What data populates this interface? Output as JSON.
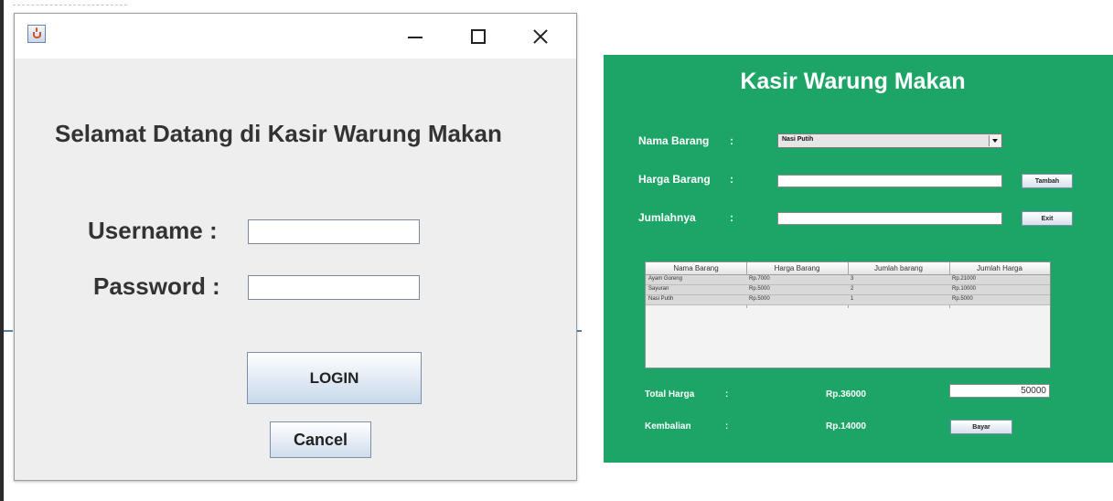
{
  "login": {
    "welcome": "Selamat Datang di Kasir Warung Makan",
    "username_label": "Username :",
    "password_label": "Password :",
    "username_value": "",
    "password_value": "",
    "login_button": "LOGIN",
    "cancel_button": "Cancel",
    "window_icon": "java-icon"
  },
  "kasir": {
    "title": "Kasir Warung Makan",
    "colon": ":",
    "nama_barang_label": "Nama Barang",
    "harga_barang_label": "Harga Barang",
    "jumlahnya_label": "Jumlahnya",
    "selected_item": "Nasi Putih",
    "harga_value": "",
    "jumlah_value": "",
    "tambah_button": "Tambah",
    "exit_button": "Exit",
    "table": {
      "headers": [
        "Nama Barang",
        "Harga Barang",
        "Jumlah barang",
        "Jumlah Harga"
      ],
      "rows": [
        [
          "Ayam Goreng",
          "Rp.7000",
          "3",
          "Rp.21000"
        ],
        [
          "Sayuran",
          "Rp.5000",
          "2",
          "Rp.10000"
        ],
        [
          "Nasi Putih",
          "Rp.5000",
          "1",
          "Rp.5000"
        ]
      ]
    },
    "total_harga_label": "Total Harga",
    "total_harga_value": "Rp.36000",
    "bayar_input": "50000",
    "kembalian_label": "Kembalian",
    "kembalian_value": "Rp.14000",
    "bayar_button": "Bayar",
    "background_color": "#1da567"
  }
}
